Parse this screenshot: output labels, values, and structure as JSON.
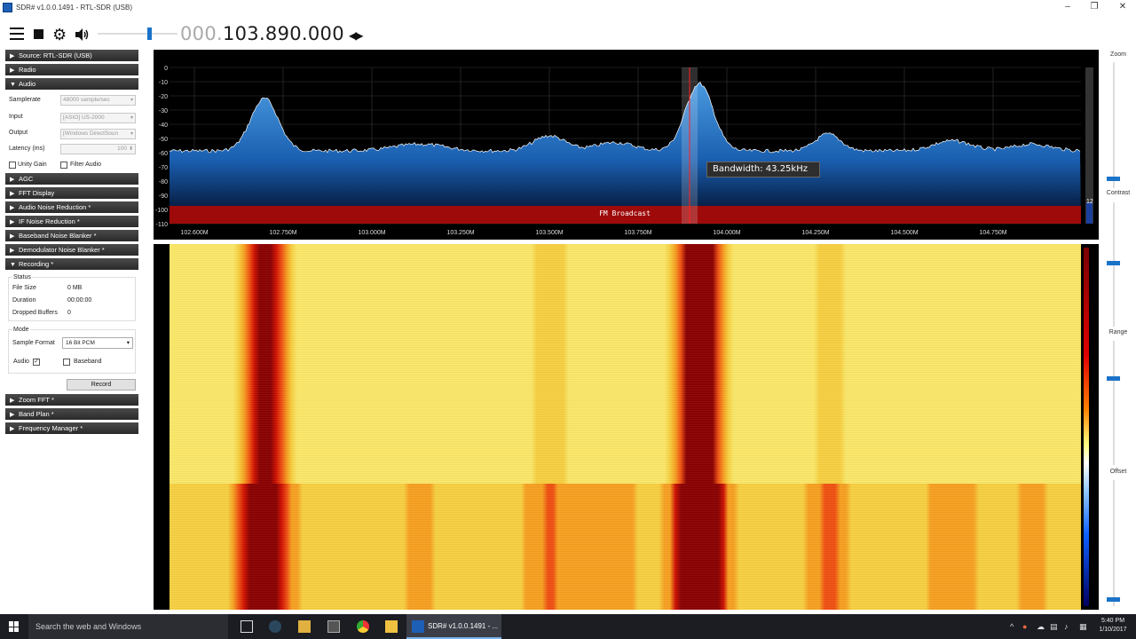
{
  "window": {
    "title": "SDR# v1.0.0.1491 - RTL-SDR (USB)",
    "minimize": "–",
    "restore": "❐",
    "close": "✕"
  },
  "toolbar": {
    "frequency_dim": "000.",
    "frequency_main": "103.890.000",
    "volume_level": 0.6
  },
  "sidebar": {
    "sections": [
      {
        "label": "Source: RTL-SDR (USB)",
        "expanded": false
      },
      {
        "label": "Radio",
        "expanded": false
      },
      {
        "label": "Audio",
        "expanded": true
      },
      {
        "label": "AGC",
        "expanded": false
      },
      {
        "label": "FFT Display",
        "expanded": false
      },
      {
        "label": "Audio Noise Reduction *",
        "expanded": false
      },
      {
        "label": "IF Noise Reduction *",
        "expanded": false
      },
      {
        "label": "Baseband Noise Blanker *",
        "expanded": false
      },
      {
        "label": "Demodulator Noise Blanker *",
        "expanded": false
      },
      {
        "label": "Recording *",
        "expanded": true
      },
      {
        "label": "Zoom FFT *",
        "expanded": false
      },
      {
        "label": "Band Plan *",
        "expanded": false
      },
      {
        "label": "Frequency Manager *",
        "expanded": false
      }
    ],
    "audio": {
      "samplerate_label": "Samplerate",
      "samplerate_value": "48000 sample/sec",
      "input_label": "Input",
      "input_value": "[ASIO] US-2000",
      "output_label": "Output",
      "output_value": "[Windows DirectSoun",
      "latency_label": "Latency (ms)",
      "latency_value": "100",
      "unity_gain_label": "Unity Gain",
      "filter_audio_label": "Filter Audio"
    },
    "recording": {
      "status_label": "Status",
      "file_size_label": "File Size",
      "file_size_value": "0 MB",
      "duration_label": "Duration",
      "duration_value": "00:00:00",
      "dropped_label": "Dropped Buffers",
      "dropped_value": "0",
      "mode_label": "Mode",
      "sample_format_label": "Sample Format",
      "sample_format_value": "16 Bit PCM",
      "audio_label": "Audio",
      "audio_checked": "✓",
      "baseband_label": "Baseband",
      "record_button": "Record"
    }
  },
  "spectrum": {
    "y_ticks": [
      "0",
      "-10",
      "-20",
      "-30",
      "-40",
      "-50",
      "-60",
      "-70",
      "-80",
      "-90",
      "-100",
      "-110"
    ],
    "x_ticks": [
      "102.600M",
      "102.750M",
      "103.000M",
      "103.250M",
      "103.500M",
      "103.750M",
      "104.000M",
      "104.250M",
      "104.500M",
      "104.750M"
    ],
    "band_label": "FM Broadcast",
    "bandwidth_tooltip": "Bandwidth: 43.25kHz",
    "side_value": "12",
    "colors": {
      "background": "#000000",
      "fill_top": "#3f8fd6",
      "fill_bottom": "#001030",
      "trace": "#ffffff",
      "band": "#9e0a0a",
      "tuned_line": "#ff2020"
    }
  },
  "right_controls": {
    "zoom_label": "Zoom",
    "contrast_label": "Contrast",
    "range_label": "Range",
    "offset_label": "Offset"
  },
  "taskbar": {
    "search_placeholder": "Search the web and Windows",
    "sdr_task_label": "SDR# v1.0.0.1491 - ...",
    "clock_time": "5:40 PM",
    "clock_date": "1/10/2017"
  }
}
